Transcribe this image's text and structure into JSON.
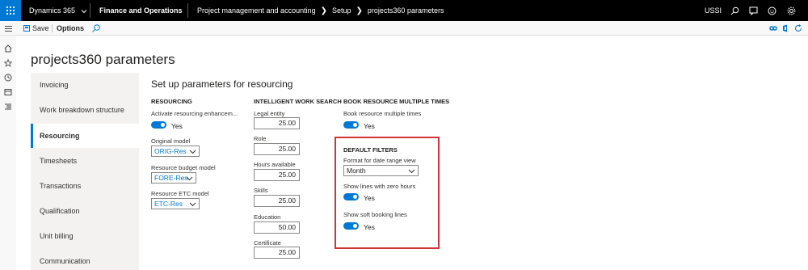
{
  "topbar": {
    "app_name": "Dynamics 365",
    "module": "Finance and Operations",
    "breadcrumbs": [
      "Project management and accounting",
      "Setup",
      "projects360 parameters"
    ],
    "company": "USSI",
    "icons": [
      "search-icon",
      "chat-icon",
      "smiley-icon",
      "gear-icon"
    ]
  },
  "actionbar": {
    "save_label": "Save",
    "options_label": "Options",
    "right_icons": [
      "link-icon",
      "office-icon",
      "refresh-icon"
    ]
  },
  "rail": {
    "icons": [
      "home-icon",
      "star-icon",
      "clock-icon",
      "workspace-icon",
      "list-icon"
    ]
  },
  "page": {
    "title": "projects360 parameters"
  },
  "tabs": [
    {
      "label": "Invoicing",
      "active": false
    },
    {
      "label": "Work breakdown structure",
      "active": false
    },
    {
      "label": "Resourcing",
      "active": true
    },
    {
      "label": "Timesheets",
      "active": false
    },
    {
      "label": "Transactions",
      "active": false
    },
    {
      "label": "Qualification",
      "active": false
    },
    {
      "label": "Unit billing",
      "active": false
    },
    {
      "label": "Communication",
      "active": false
    }
  ],
  "main": {
    "section_title": "Set up parameters for resourcing",
    "resourcing": {
      "header": "RESOURCING",
      "activate_label": "Activate resourcing enhancem...",
      "activate_value": "Yes",
      "original_model_label": "Original model",
      "original_model_value": "ORIG-Res",
      "budget_model_label": "Resource budget model",
      "budget_model_value": "FORE-Res",
      "etc_model_label": "Resource ETC model",
      "etc_model_value": "ETC-Res"
    },
    "intelligent_search": {
      "header": "INTELLIGENT WORK SEARCH",
      "fields": [
        {
          "label": "Legal entity",
          "value": "25.00"
        },
        {
          "label": "Role",
          "value": "25.00"
        },
        {
          "label": "Hours available",
          "value": "25.00"
        },
        {
          "label": "Skills",
          "value": "25.00"
        },
        {
          "label": "Education",
          "value": "50.00"
        },
        {
          "label": "Certificate",
          "value": "25.00"
        }
      ]
    },
    "book_multiple": {
      "header": "BOOK RESOURCE MULTIPLE TIMES",
      "label": "Book resource multiple times",
      "value": "Yes"
    },
    "default_filters": {
      "header": "DEFAULT FILTERS",
      "date_range_label": "Format for date range view",
      "date_range_value": "Month",
      "zero_hours_label": "Show lines with zero hours",
      "zero_hours_value": "Yes",
      "soft_booking_label": "Show soft booking lines",
      "soft_booking_value": "Yes"
    }
  },
  "colors": {
    "accent": "#0078d4",
    "topbar": "#000000",
    "highlight": "#d13438"
  }
}
